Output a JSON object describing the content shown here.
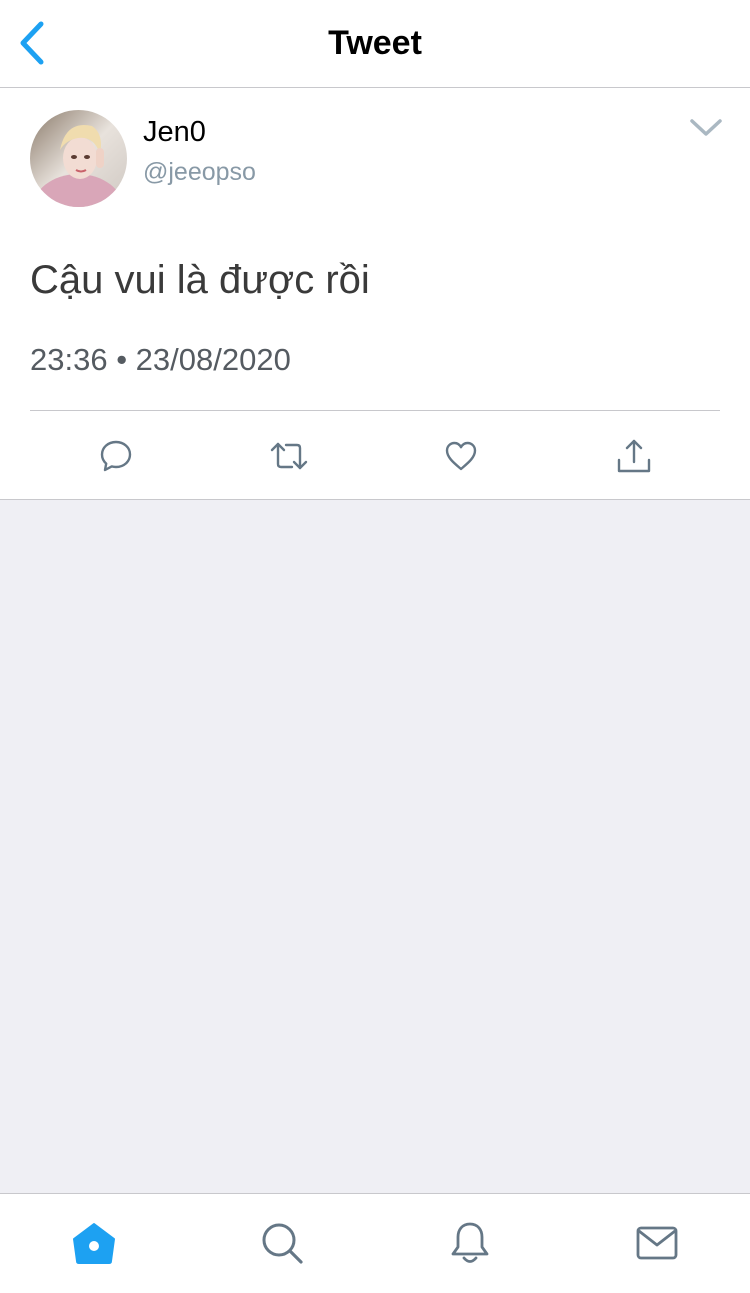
{
  "nav": {
    "title": "Tweet",
    "back_icon": "chevron-left-icon"
  },
  "tweet": {
    "author": {
      "display_name": "Jen0",
      "handle": "@jeeopso"
    },
    "text": "Cậu vui là được rồi",
    "timestamp": "23:36 • 23/08/2020",
    "menu_icon": "chevron-down-icon",
    "actions": [
      {
        "name": "reply",
        "icon": "speech-bubble-icon"
      },
      {
        "name": "retweet",
        "icon": "retweet-icon"
      },
      {
        "name": "like",
        "icon": "heart-icon"
      },
      {
        "name": "share",
        "icon": "share-icon"
      }
    ]
  },
  "tabbar": {
    "tabs": [
      {
        "name": "home",
        "icon": "home-icon",
        "active": true
      },
      {
        "name": "search",
        "icon": "search-icon",
        "active": false
      },
      {
        "name": "notifications",
        "icon": "bell-icon",
        "active": false
      },
      {
        "name": "messages",
        "icon": "mail-icon",
        "active": false
      }
    ]
  },
  "colors": {
    "accent": "#1da1f2",
    "icon_gray": "#657786",
    "handle_gray": "#8899a6",
    "background": "#efeff4"
  }
}
